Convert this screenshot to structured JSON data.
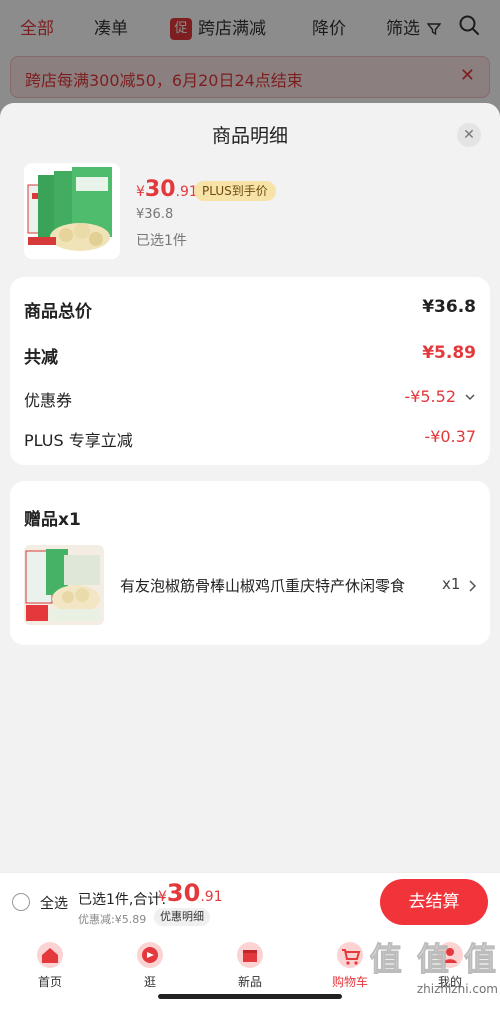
{
  "topnav": {
    "tabs": [
      "全部",
      "凑单",
      "跨店满减",
      "降价",
      "筛选"
    ],
    "promo_badge": "促"
  },
  "banner": {
    "text": "跨店每满300减50，6月20日24点结束",
    "close": "✕"
  },
  "sheet": {
    "title": "商品明细",
    "close": "✕",
    "product": {
      "currency": "¥",
      "price_int": "30",
      "price_dec": ".91",
      "plus_tag": "PLUS到手价",
      "original_price": "¥36.8",
      "selected": "已选1件"
    },
    "breakdown": {
      "total_label": "商品总价",
      "total_value": "¥36.8",
      "reduce_label": "共减",
      "reduce_value": "¥5.89",
      "coupon_label": "优惠券",
      "coupon_value": "-¥5.52",
      "plus_label": "PLUS 专享立减",
      "plus_value": "-¥0.37"
    },
    "gift": {
      "title": "赠品x1",
      "name": "有友泡椒筋骨棒山椒鸡爪重庆特产休闲零食",
      "qty": "x1"
    }
  },
  "checkout": {
    "select_all": "全选",
    "summary": "已选1件,合计:",
    "currency": "¥",
    "price_int": "30",
    "price_dec": ".91",
    "discount": "优惠减:¥5.89",
    "detail_chip": "优惠明细",
    "button": "去结算"
  },
  "tabbar": {
    "items": [
      {
        "label": "首页"
      },
      {
        "label": "逛"
      },
      {
        "label": "新品"
      },
      {
        "label": "购物车"
      },
      {
        "label": "我的"
      }
    ]
  },
  "watermark": {
    "text": "值 值 值",
    "url": "zhizhizhi.com"
  },
  "colors": {
    "accent": "#e4393c",
    "plus_tag": "#f7e2a8"
  }
}
